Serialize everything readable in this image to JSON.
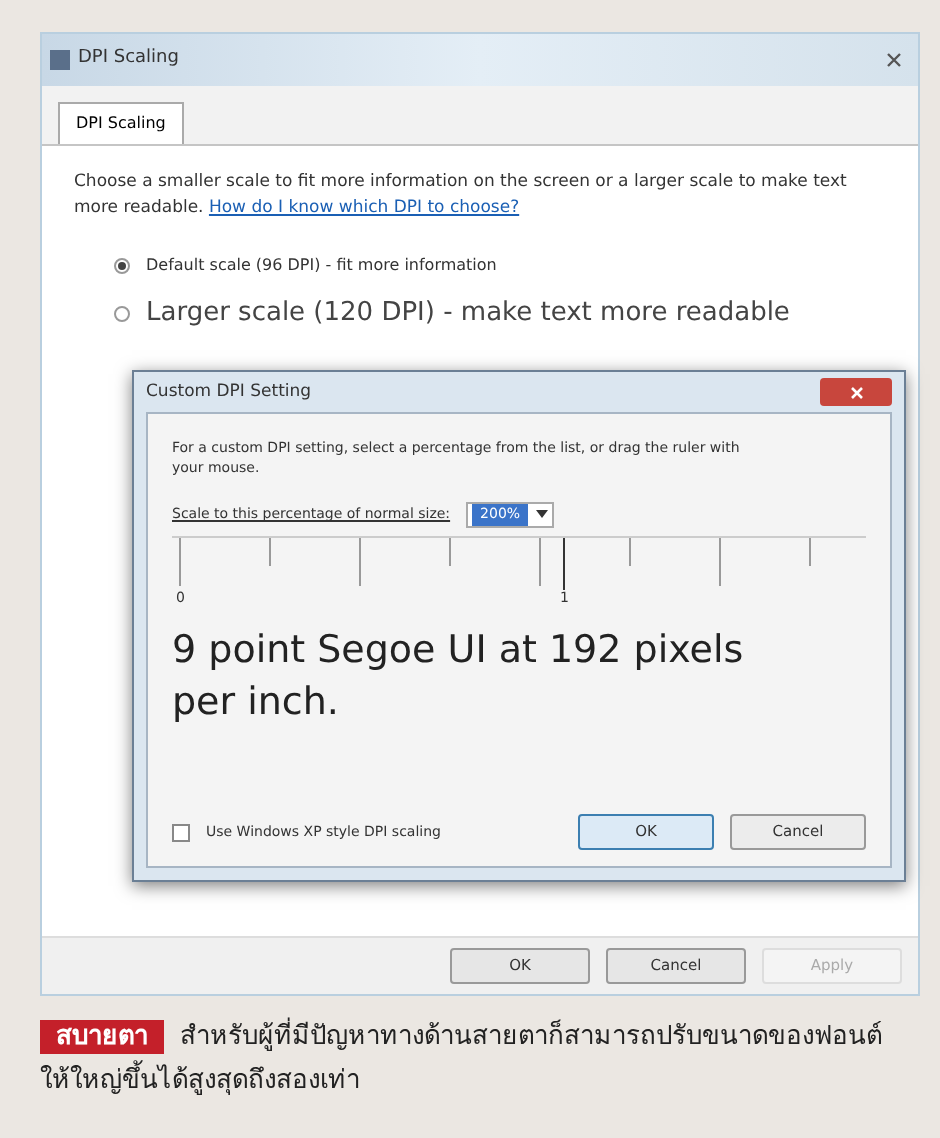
{
  "window": {
    "title": "DPI Scaling"
  },
  "tabs": [
    {
      "label": "DPI Scaling",
      "selected": true
    }
  ],
  "description": {
    "text": "Choose a smaller scale to fit more information on the screen or a larger scale to make text more readable.",
    "link": "How do I know which DPI to choose?"
  },
  "options": [
    {
      "label": "Default scale (96 DPI) - fit more information",
      "selected": true
    },
    {
      "label": "Larger scale (120 DPI) - make text more readable",
      "selected": false
    }
  ],
  "dialog": {
    "title": "Custom DPI Setting",
    "instructions": "For a custom DPI setting, select a percentage from the list, or drag the ruler with your mouse.",
    "scale_label": "Scale to this percentage of normal size:",
    "scale_value": "200%",
    "ruler_labels": [
      "0",
      "1"
    ],
    "preview": "9 point Segoe UI at 192 pixels per inch.",
    "xp_scaling": {
      "label": "Use Windows XP style DPI scaling",
      "checked": false
    },
    "buttons": [
      {
        "label": "OK",
        "default": true
      },
      {
        "label": "Cancel",
        "default": false
      }
    ]
  },
  "buttons": [
    {
      "label": "OK",
      "disabled": false
    },
    {
      "label": "Cancel",
      "disabled": false
    },
    {
      "label": "Apply",
      "disabled": true
    }
  ],
  "caption": {
    "tag": "สบายตา",
    "text": "สำหรับผู้ที่มีปัญหาทางด้านสายตาก็สามารถปรับขนาดของฟอนต์ให้ใหญ่ขึ้นได้สูงสุดถึงสองเท่า"
  }
}
